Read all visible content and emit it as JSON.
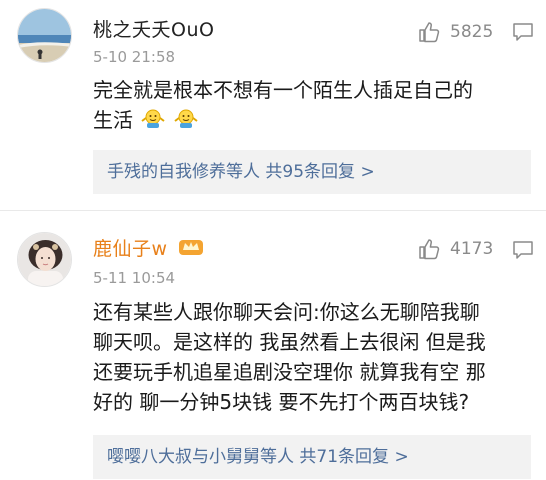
{
  "comments": [
    {
      "username": "桃之夭夭OuO",
      "time": "5-10 21:58",
      "likes": "5825",
      "lines": [
        "完全就是根本不想有一个陌生人插足自己的",
        "生活"
      ],
      "emoji": "shrug-emoji x2",
      "replies_text": "手残的自我修养等人  共95条回复 >"
    },
    {
      "username": "鹿仙子w",
      "time": "5-11 10:54",
      "likes": "4173",
      "lines": [
        "还有某些人跟你聊天会问:你这么无聊陪我聊",
        "聊天呗。是这样的 我虽然看上去很闲 但是我",
        "还要玩手机追星追剧没空理你 就算我有空 那",
        "好的 聊一分钟5块钱 要不先打个两百块钱?"
      ],
      "replies_text": "嘤嘤八大叔与小舅舅等人  共71条回复 >"
    }
  ],
  "colors": {
    "vip_name": "#e8801a",
    "reply_link": "#4e6e9a",
    "meta_gray": "#9a9a9a"
  }
}
